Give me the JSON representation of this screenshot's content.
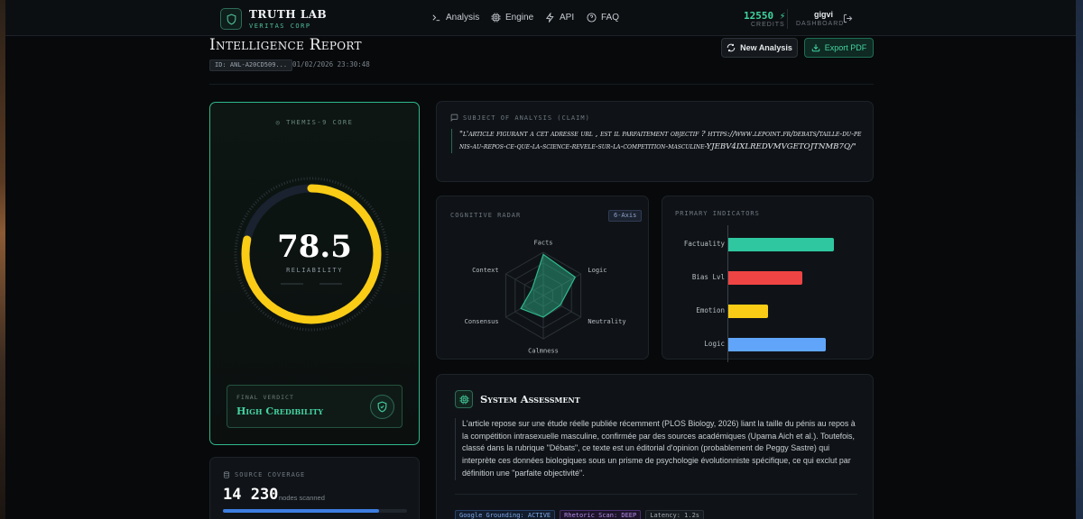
{
  "nav": {
    "brand_title": "TRUTH LAB",
    "brand_subtitle": "VERITAS CORP",
    "items": [
      {
        "label": "Analysis",
        "icon": "terminal-icon"
      },
      {
        "label": "Engine",
        "icon": "cpu-icon"
      },
      {
        "label": "API",
        "icon": "zap-icon"
      },
      {
        "label": "FAQ",
        "icon": "help-circle-icon"
      }
    ],
    "credits_value": "12550",
    "credits_label": "CREDITS",
    "user_name": "gigvi",
    "user_label": "DASHBOARD"
  },
  "header": {
    "title": "Intelligence Report",
    "report_id": "ID: ANL-A20CD509...",
    "date": "01/02/2026 23:30:48",
    "new_analysis_label": "New Analysis",
    "export_label": "Export PDF"
  },
  "score": {
    "core_label": "THEMIS-9 CORE",
    "value": "78.5",
    "value_fraction": 0.785,
    "label": "RELIABILITY",
    "verdict_label": "FINAL VERDICT",
    "verdict_value": "High Credibility"
  },
  "source": {
    "label": "SOURCE COVERAGE",
    "value": "14 230",
    "unit": "nodes scanned",
    "fill_fraction": 0.85
  },
  "claim": {
    "label": "SUBJECT OF ANALYSIS (CLAIM)",
    "text": "\"l'article figurant a cet adresse url , est il parfaitement objectif ? https://www.lepoint.fr/debats/taille-du-penis-au-repos-ce-que-la-science-revele-sur-la-competition-masculine-YJEBV4IXLREDVMVGETOJTNMB7Q/\""
  },
  "radar": {
    "label": "COGNITIVE RADAR",
    "badge": "6-Axis",
    "axes": [
      "Facts",
      "Logic",
      "Neutrality",
      "Calmness",
      "Consensus",
      "Context"
    ],
    "values": [
      0.95,
      0.85,
      0.45,
      0.5,
      0.6,
      0.3
    ],
    "fill_color": "#2fb88b"
  },
  "indicators": {
    "label": "PRIMARY INDICATORS",
    "items": [
      {
        "name": "Factuality",
        "value": 0.9,
        "color": "#2fc7a0"
      },
      {
        "name": "Bias Lvl",
        "value": 0.63,
        "color": "#ef4444"
      },
      {
        "name": "Emotion",
        "value": 0.34,
        "color": "#facc15"
      },
      {
        "name": "Logic",
        "value": 0.83,
        "color": "#60a5fa"
      }
    ]
  },
  "assessment": {
    "title": "System Assessment",
    "body": "L'article repose sur une étude réelle publiée récemment (PLOS Biology, 2026) liant la taille du pénis au repos à la compétition intrasexuelle masculine, confirmée par des sources académiques (Upama Aich et al.). Toutefois, classé dans la rubrique \"Débats\", ce texte est un éditorial d'opinion (probablement de Peggy Sastre) qui interprète ces données biologiques sous un prisme de psychologie évolutionniste spécifique, ce qui exclut par définition une \"parfaite objectivité\".",
    "tags": [
      "Google Grounding: ACTIVE",
      "Rhetoric Scan: DEEP",
      "Latency: 1.2s"
    ]
  },
  "colors": {
    "accent": "#2fb88b",
    "gauge": "#facc15",
    "background": "#07090b"
  }
}
